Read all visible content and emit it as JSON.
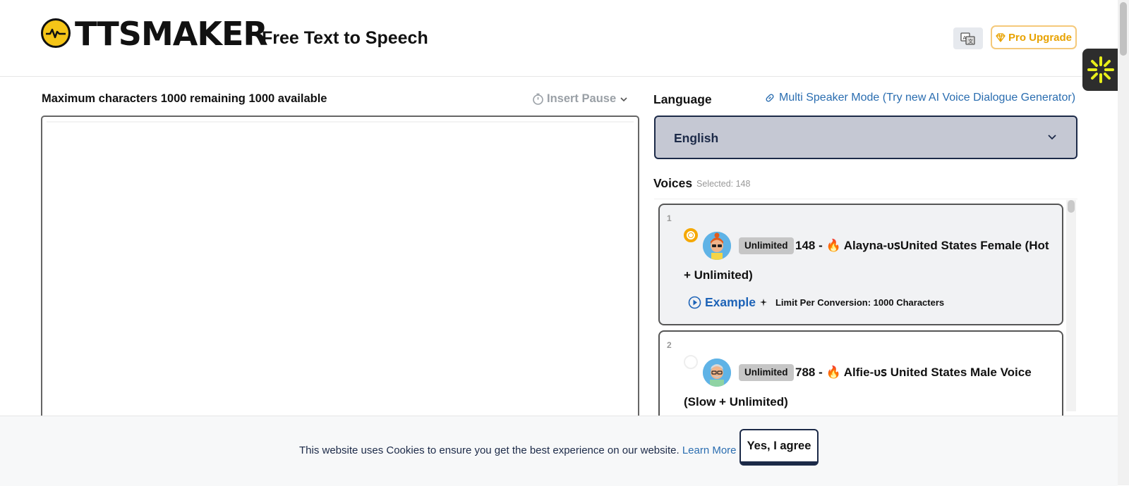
{
  "header": {
    "logo_text": "TTSMAKER",
    "tagline": "Free Text to Speech",
    "pro_upgrade_label": "Pro Upgrade",
    "accent_color": "#f5c518"
  },
  "editor": {
    "char_label": "Maximum characters 1000 remaining 1000 available",
    "insert_pause_label": "Insert Pause",
    "text_value": ""
  },
  "language": {
    "label": "Language",
    "multi_speaker_link": "Multi Speaker Mode (Try new AI Voice Dialogue Generator)",
    "selected": "English"
  },
  "voices": {
    "label": "Voices",
    "selected_text": "Selected: 148",
    "items": [
      {
        "index": "1",
        "badge": "Unlimited",
        "title_line1": "148 - 🔥 Alayna-ᴜꜱUnited States Female (Hot",
        "title_line2": "+ Unlimited)",
        "example_label": "Example",
        "limit_text": "Limit Per Conversion: 1000 Characters",
        "selected": true
      },
      {
        "index": "2",
        "badge": "Unlimited",
        "title_line1": "788 - 🔥 Alfie-ᴜꜱ United States Male Voice",
        "title_line2": "(Slow + Unlimited)",
        "selected": false
      }
    ]
  },
  "cookie": {
    "message": "This website uses Cookies to ensure you get the best experience on our website.",
    "learn_more": "Learn More",
    "agree_label": "Yes, I agree"
  }
}
